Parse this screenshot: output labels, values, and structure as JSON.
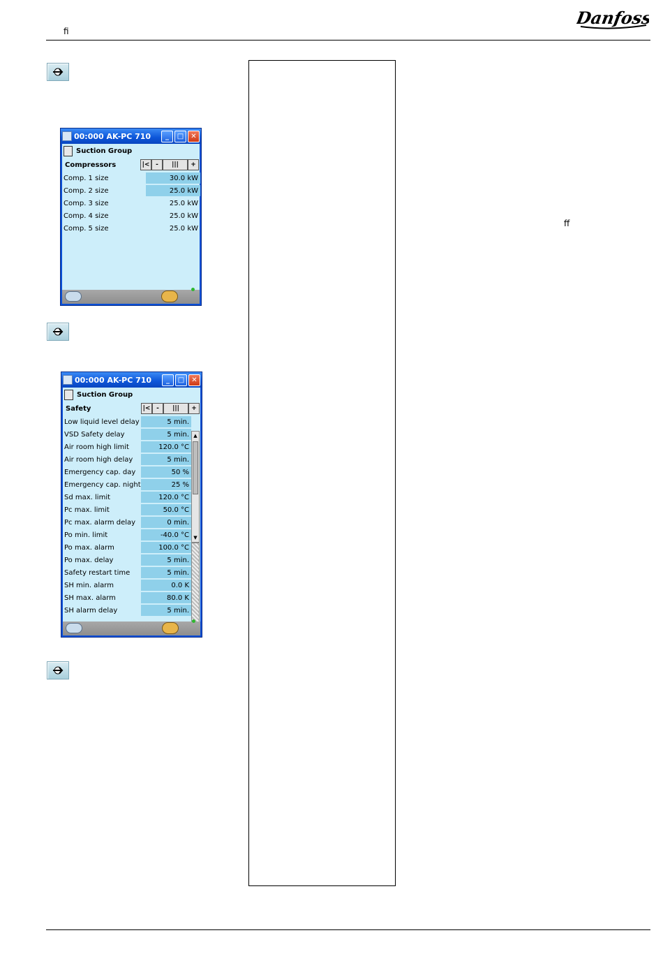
{
  "header": {
    "glyph": "ﬁ"
  },
  "side_note": {
    "glyph": "ﬀ"
  },
  "logo": {
    "text": "Danfoss"
  },
  "window1": {
    "title": "00:000 AK-PC 710",
    "group": "Suction Group",
    "section": "Compressors",
    "rows": [
      {
        "label": "Comp. 1 size",
        "value": "30.0 kW"
      },
      {
        "label": "Comp. 2 size",
        "value": "25.0 kW"
      },
      {
        "label": "Comp. 3 size",
        "value": "25.0 kW"
      },
      {
        "label": "Comp. 4 size",
        "value": "25.0 kW"
      },
      {
        "label": "Comp. 5 size",
        "value": "25.0 kW"
      }
    ]
  },
  "window2": {
    "title": "00:000 AK-PC 710",
    "group": "Suction Group",
    "section": "Safety",
    "rows": [
      {
        "label": "Low liquid level delay",
        "value": "5 min."
      },
      {
        "label": "VSD Safety delay",
        "value": "5 min."
      },
      {
        "label": "Air room high limit",
        "value": "120.0 °C"
      },
      {
        "label": "Air room high delay",
        "value": "5 min."
      },
      {
        "label": "Emergency cap. day",
        "value": "50 %"
      },
      {
        "label": "Emergency cap. night",
        "value": "25 %"
      },
      {
        "label": "Sd max. limit",
        "value": "120.0 °C"
      },
      {
        "label": "Pc max. limit",
        "value": "50.0 °C"
      },
      {
        "label": "Pc max. alarm delay",
        "value": "0 min."
      },
      {
        "label": "Po min. limit",
        "value": "-40.0 °C"
      },
      {
        "label": "Po max. alarm",
        "value": "100.0 °C"
      },
      {
        "label": "Po max. delay",
        "value": "5 min."
      },
      {
        "label": "Safety restart time",
        "value": "5 min."
      },
      {
        "label": "SH min. alarm",
        "value": "0.0 K"
      },
      {
        "label": "SH max. alarm",
        "value": "80.0 K"
      },
      {
        "label": "SH alarm delay",
        "value": "5 min."
      }
    ]
  }
}
